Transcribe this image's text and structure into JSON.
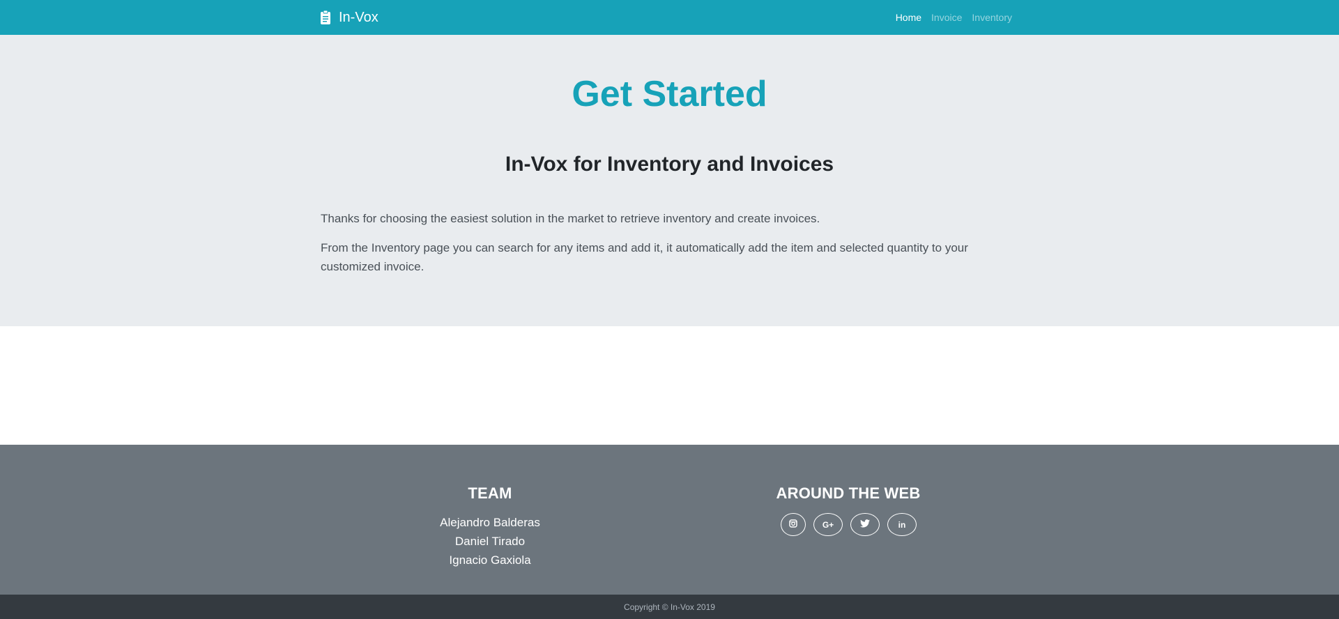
{
  "navbar": {
    "brand": "In-Vox",
    "brand_icon": "clipboard-icon",
    "links": [
      {
        "label": "Home",
        "active": true
      },
      {
        "label": "Invoice",
        "active": false
      },
      {
        "label": "Inventory",
        "active": false
      }
    ]
  },
  "hero": {
    "title": "Get Started",
    "subtitle": "In-Vox for Inventory and Invoices",
    "paragraph_1": "Thanks for choosing the easiest solution in the market to retrieve inventory and create invoices.",
    "paragraph_2": "From the Inventory page you can search for any items and add it, it automatically add the item and selected quantity to your customized invoice."
  },
  "footer": {
    "team": {
      "heading": "TEAM",
      "members": [
        "Alejandro Balderas",
        "Daniel Tirado",
        "Ignacio Gaxiola"
      ]
    },
    "around_the_web": {
      "heading": "AROUND THE WEB",
      "social": [
        {
          "icon": "instagram-icon",
          "glyph": "◙"
        },
        {
          "icon": "google-plus-icon",
          "glyph": "G+"
        },
        {
          "icon": "twitter-icon",
          "glyph": "🐦"
        },
        {
          "icon": "linkedin-icon",
          "glyph": "in"
        }
      ]
    }
  },
  "copyright": "Copyright © In-Vox 2019",
  "colors": {
    "primary": "#17a2b8",
    "hero_bg": "#e9ecef",
    "footer_bg": "#6c757d",
    "copyright_bg": "#343a40"
  }
}
